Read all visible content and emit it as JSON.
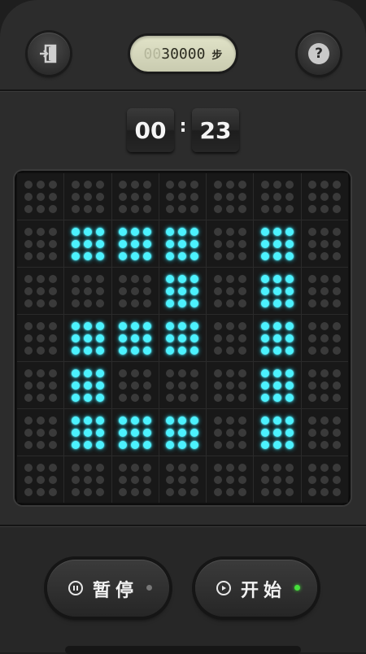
{
  "header": {
    "step_counter": {
      "ghost_digits": "00",
      "value": "30000",
      "unit": "步"
    },
    "exit_icon": "exit-door-icon",
    "help_icon": "question-icon",
    "help_glyph": "?"
  },
  "timer": {
    "minutes": "00",
    "separator": ":",
    "seconds": "23"
  },
  "board": {
    "rows": 7,
    "cols": 7,
    "lit_color": "#4cf2ff",
    "unlit_color": "#3a3a3a",
    "lit_cells": [
      [
        0,
        0,
        0,
        0,
        0,
        0,
        0
      ],
      [
        0,
        1,
        1,
        1,
        0,
        1,
        0
      ],
      [
        0,
        0,
        0,
        1,
        0,
        1,
        0
      ],
      [
        0,
        1,
        1,
        1,
        0,
        1,
        0
      ],
      [
        0,
        1,
        0,
        0,
        0,
        1,
        0
      ],
      [
        0,
        1,
        1,
        1,
        0,
        1,
        0
      ],
      [
        0,
        0,
        0,
        0,
        0,
        0,
        0
      ]
    ]
  },
  "controls": {
    "pause": {
      "label": "暂停",
      "icon": "pause-circle-icon",
      "led_color": "#777777"
    },
    "start": {
      "label": "开始",
      "icon": "play-circle-icon",
      "led_color": "#46e03c"
    }
  }
}
